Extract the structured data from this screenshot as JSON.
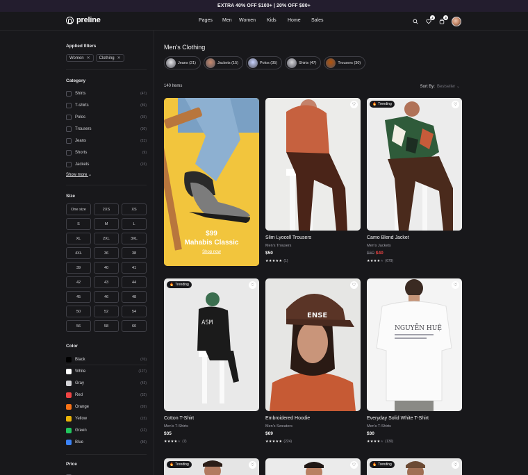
{
  "promo_banner": "EXTRA 40% OFF $100+ | 20% OFF $80+",
  "header": {
    "logo": "preline",
    "nav": [
      "Pages",
      "Men",
      "Women",
      "Kids",
      "Home",
      "Sales"
    ],
    "wishlist_count": "2",
    "cart_count": "3"
  },
  "filters": {
    "applied_title": "Applied filters",
    "applied": [
      "Women",
      "Clothing"
    ],
    "category_title": "Category",
    "categories": [
      {
        "label": "Shirts",
        "count": "(47)"
      },
      {
        "label": "T-shirts",
        "count": "(89)"
      },
      {
        "label": "Polos",
        "count": "(35)"
      },
      {
        "label": "Trousers",
        "count": "(30)"
      },
      {
        "label": "Jeans",
        "count": "(21)"
      },
      {
        "label": "Shorts",
        "count": "(9)"
      },
      {
        "label": "Jackets",
        "count": "(15)"
      }
    ],
    "show_more": "Show more",
    "size_title": "Size",
    "sizes": [
      "One size",
      "2XS",
      "XS",
      "S",
      "M",
      "L",
      "XL",
      "2XL",
      "3XL",
      "4XL",
      "36",
      "38",
      "39",
      "40",
      "41",
      "42",
      "43",
      "44",
      "45",
      "46",
      "48",
      "50",
      "52",
      "54",
      "56",
      "58",
      "60"
    ],
    "color_title": "Color",
    "colors": [
      {
        "label": "Black",
        "count": "(70)",
        "hex": "#000000"
      },
      {
        "label": "White",
        "count": "(127)",
        "hex": "#ffffff"
      },
      {
        "label": "Gray",
        "count": "(43)",
        "hex": "#d4d4d8"
      },
      {
        "label": "Red",
        "count": "(32)",
        "hex": "#ef4444"
      },
      {
        "label": "Orange",
        "count": "(26)",
        "hex": "#f97316"
      },
      {
        "label": "Yellow",
        "count": "(15)",
        "hex": "#eab308"
      },
      {
        "label": "Green",
        "count": "(12)",
        "hex": "#22c55e"
      },
      {
        "label": "Blue",
        "count": "(86)",
        "hex": "#3b82f6"
      }
    ],
    "price_title": "Price"
  },
  "main": {
    "title": "Men's Clothing",
    "category_chips": [
      {
        "label": "Jeans (21)",
        "color": "#e4e4e7"
      },
      {
        "label": "Jackets (15)",
        "color": "#c88a6e"
      },
      {
        "label": "Polos (35)",
        "color": "#c7d2fe"
      },
      {
        "label": "Shirts (47)",
        "color": "#d4d4d8"
      },
      {
        "label": "Trousers (30)",
        "color": "#b45309"
      }
    ],
    "items_count": "140 Items",
    "sort_label": "Sort By:",
    "sort_value": "Bestseller",
    "promo": {
      "price": "$99",
      "name": "Mahabis Classic",
      "link": "Shop now"
    },
    "trending_label": "Trending",
    "products": [
      {
        "name": "Slim Lyocell Trousers",
        "category": "Men's Trousers",
        "price": "$50",
        "rating": 5,
        "reviews": "(1)"
      },
      {
        "name": "Camo Blend Jacket",
        "category": "Men's Jackets",
        "old_price": "$60",
        "price": "$40",
        "rating": 4,
        "reviews": "(679)",
        "trending": true
      },
      {
        "name": "Cotton T-Shirt",
        "category": "Men's T-Shirts",
        "price": "$35",
        "rating": 4,
        "reviews": "(7)",
        "trending": true
      },
      {
        "name": "Embroidered Hoodie",
        "category": "Men's Sweaters",
        "price": "$69",
        "rating": 5,
        "reviews": "(224)"
      },
      {
        "name": "Everyday Solid White T-Shirt",
        "category": "Men's T-Shirts",
        "price": "$30",
        "rating": 4,
        "reviews": "(130)"
      }
    ]
  }
}
